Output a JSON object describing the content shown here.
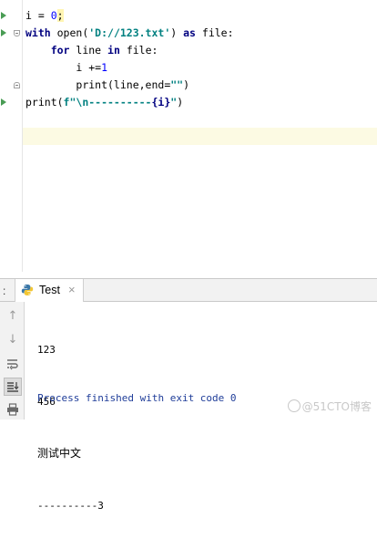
{
  "editor": {
    "lines": [
      {
        "indent": "",
        "tokens": [
          {
            "t": "i = ",
            "c": "plain"
          },
          {
            "t": "0",
            "c": "num"
          },
          {
            "t": ";",
            "c": "caret"
          }
        ]
      },
      {
        "indent": "",
        "tokens": [
          {
            "t": "with",
            "c": "kw"
          },
          {
            "t": " open(",
            "c": "plain"
          },
          {
            "t": "'D://123.txt'",
            "c": "str"
          },
          {
            "t": ") ",
            "c": "plain"
          },
          {
            "t": "as",
            "c": "kw"
          },
          {
            "t": " file:",
            "c": "plain"
          }
        ]
      },
      {
        "indent": "    ",
        "tokens": [
          {
            "t": "for",
            "c": "kw"
          },
          {
            "t": " line ",
            "c": "plain"
          },
          {
            "t": "in",
            "c": "kw"
          },
          {
            "t": " file:",
            "c": "plain"
          }
        ]
      },
      {
        "indent": "        ",
        "tokens": [
          {
            "t": "i +=",
            "c": "plain"
          },
          {
            "t": "1",
            "c": "num"
          }
        ]
      },
      {
        "indent": "        ",
        "tokens": [
          {
            "t": "print(line,end=",
            "c": "plain"
          },
          {
            "t": "\"\"",
            "c": "str"
          },
          {
            "t": ")",
            "c": "plain"
          }
        ]
      },
      {
        "indent": "",
        "tokens": [
          {
            "t": "print(",
            "c": "plain"
          },
          {
            "t": "f\"\\n----------",
            "c": "str"
          },
          {
            "t": "{i}",
            "c": "brace"
          },
          {
            "t": "\"",
            "c": "str"
          },
          {
            "t": ")",
            "c": "plain"
          }
        ]
      }
    ]
  },
  "run_panel": {
    "tab_label": "Test",
    "tab_close": "×",
    "toolbar_icons": [
      "arrow-up-icon",
      "arrow-down-icon",
      "soft-wrap-icon",
      "scroll-to-end-icon",
      "print-icon"
    ],
    "output_lines": [
      "123",
      "456",
      "测试中文",
      "----------3"
    ],
    "exit_message": "Process finished with exit code 0"
  },
  "watermark": "@51CTO博客"
}
